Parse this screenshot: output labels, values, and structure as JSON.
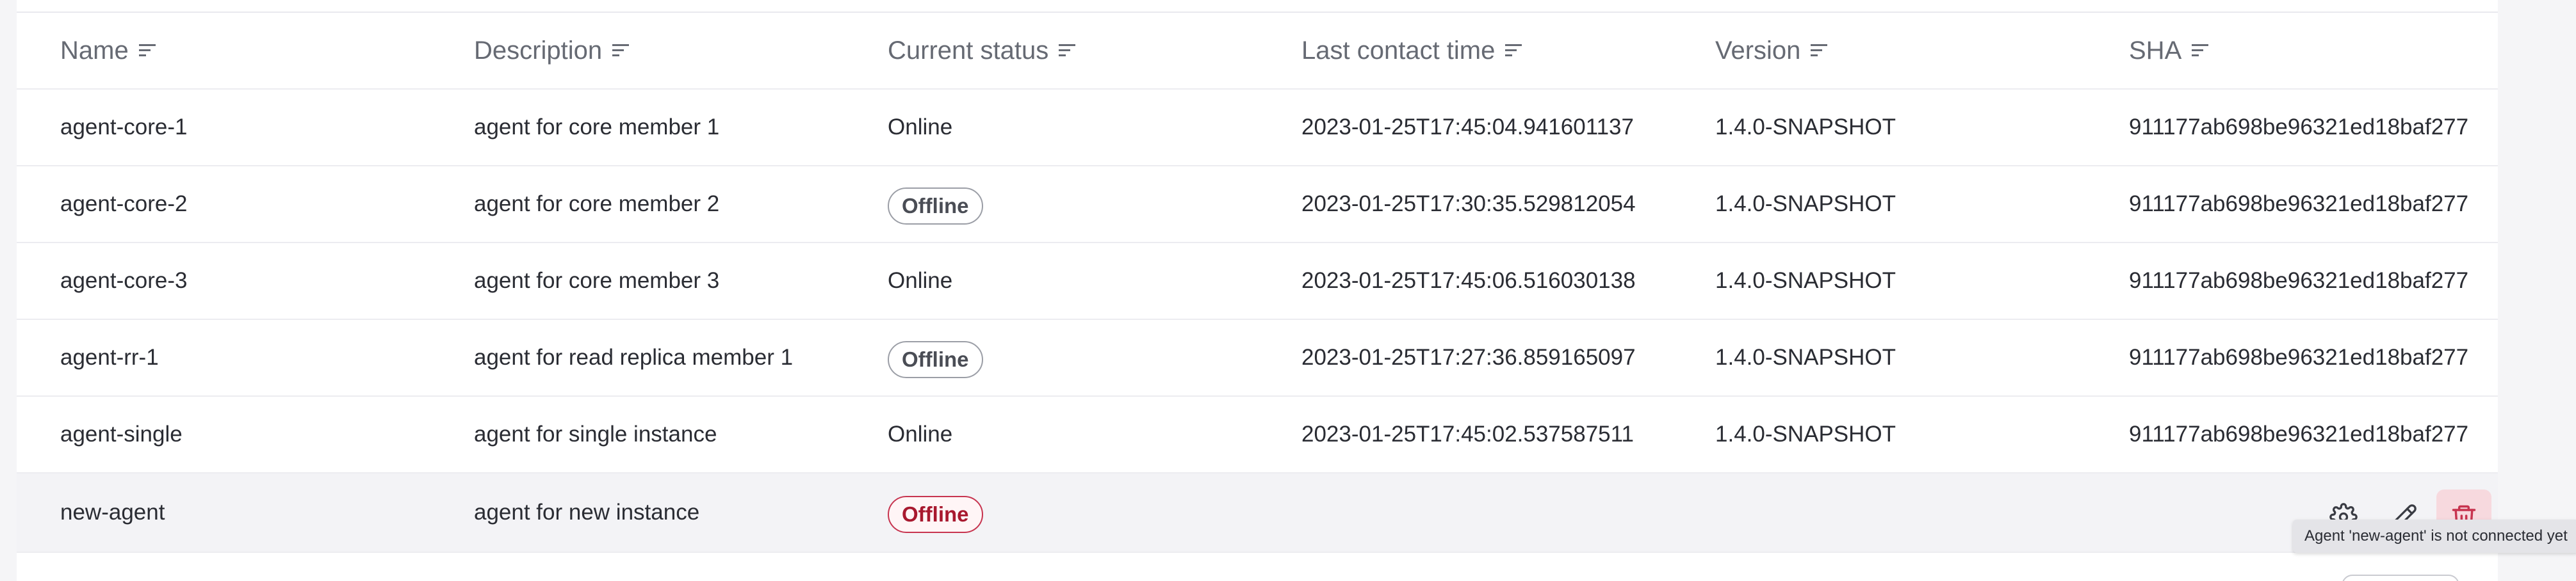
{
  "table": {
    "columns": [
      "Name",
      "Description",
      "Current status",
      "Last contact time",
      "Version",
      "SHA"
    ],
    "rows": [
      {
        "name": "agent-core-1",
        "description": "agent for core member 1",
        "status": "Online",
        "status_style": "plain",
        "last_contact": "2023-01-25T17:45:04.941601137",
        "version": "1.4.0-SNAPSHOT",
        "sha": "911177ab698be96321ed18baf277"
      },
      {
        "name": "agent-core-2",
        "description": "agent for core member 2",
        "status": "Offline",
        "status_style": "badge",
        "last_contact": "2023-01-25T17:30:35.529812054",
        "version": "1.4.0-SNAPSHOT",
        "sha": "911177ab698be96321ed18baf277"
      },
      {
        "name": "agent-core-3",
        "description": "agent for core member 3",
        "status": "Online",
        "status_style": "plain",
        "last_contact": "2023-01-25T17:45:06.516030138",
        "version": "1.4.0-SNAPSHOT",
        "sha": "911177ab698be96321ed18baf277"
      },
      {
        "name": "agent-rr-1",
        "description": "agent for read replica member 1",
        "status": "Offline",
        "status_style": "badge",
        "last_contact": "2023-01-25T17:27:36.859165097",
        "version": "1.4.0-SNAPSHOT",
        "sha": "911177ab698be96321ed18baf277"
      },
      {
        "name": "agent-single",
        "description": "agent for single instance",
        "status": "Online",
        "status_style": "plain",
        "last_contact": "2023-01-25T17:45:02.537587511",
        "version": "1.4.0-SNAPSHOT",
        "sha": "911177ab698be96321ed18baf277"
      },
      {
        "name": "new-agent",
        "description": "agent for new instance",
        "status": "Offline",
        "status_style": "danger-badge",
        "last_contact": "",
        "version": "",
        "sha": ""
      }
    ]
  },
  "row_actions": {
    "icons": [
      "settings-gear-icon",
      "edit-pencil-icon",
      "delete-trash-icon"
    ]
  },
  "tooltip": {
    "text": "Agent 'new-agent' is not connected yet"
  },
  "colors": {
    "danger": "#c7344f",
    "danger_bg": "#f7d9de",
    "header_text": "#666a73",
    "body_text": "#2a2c33"
  }
}
